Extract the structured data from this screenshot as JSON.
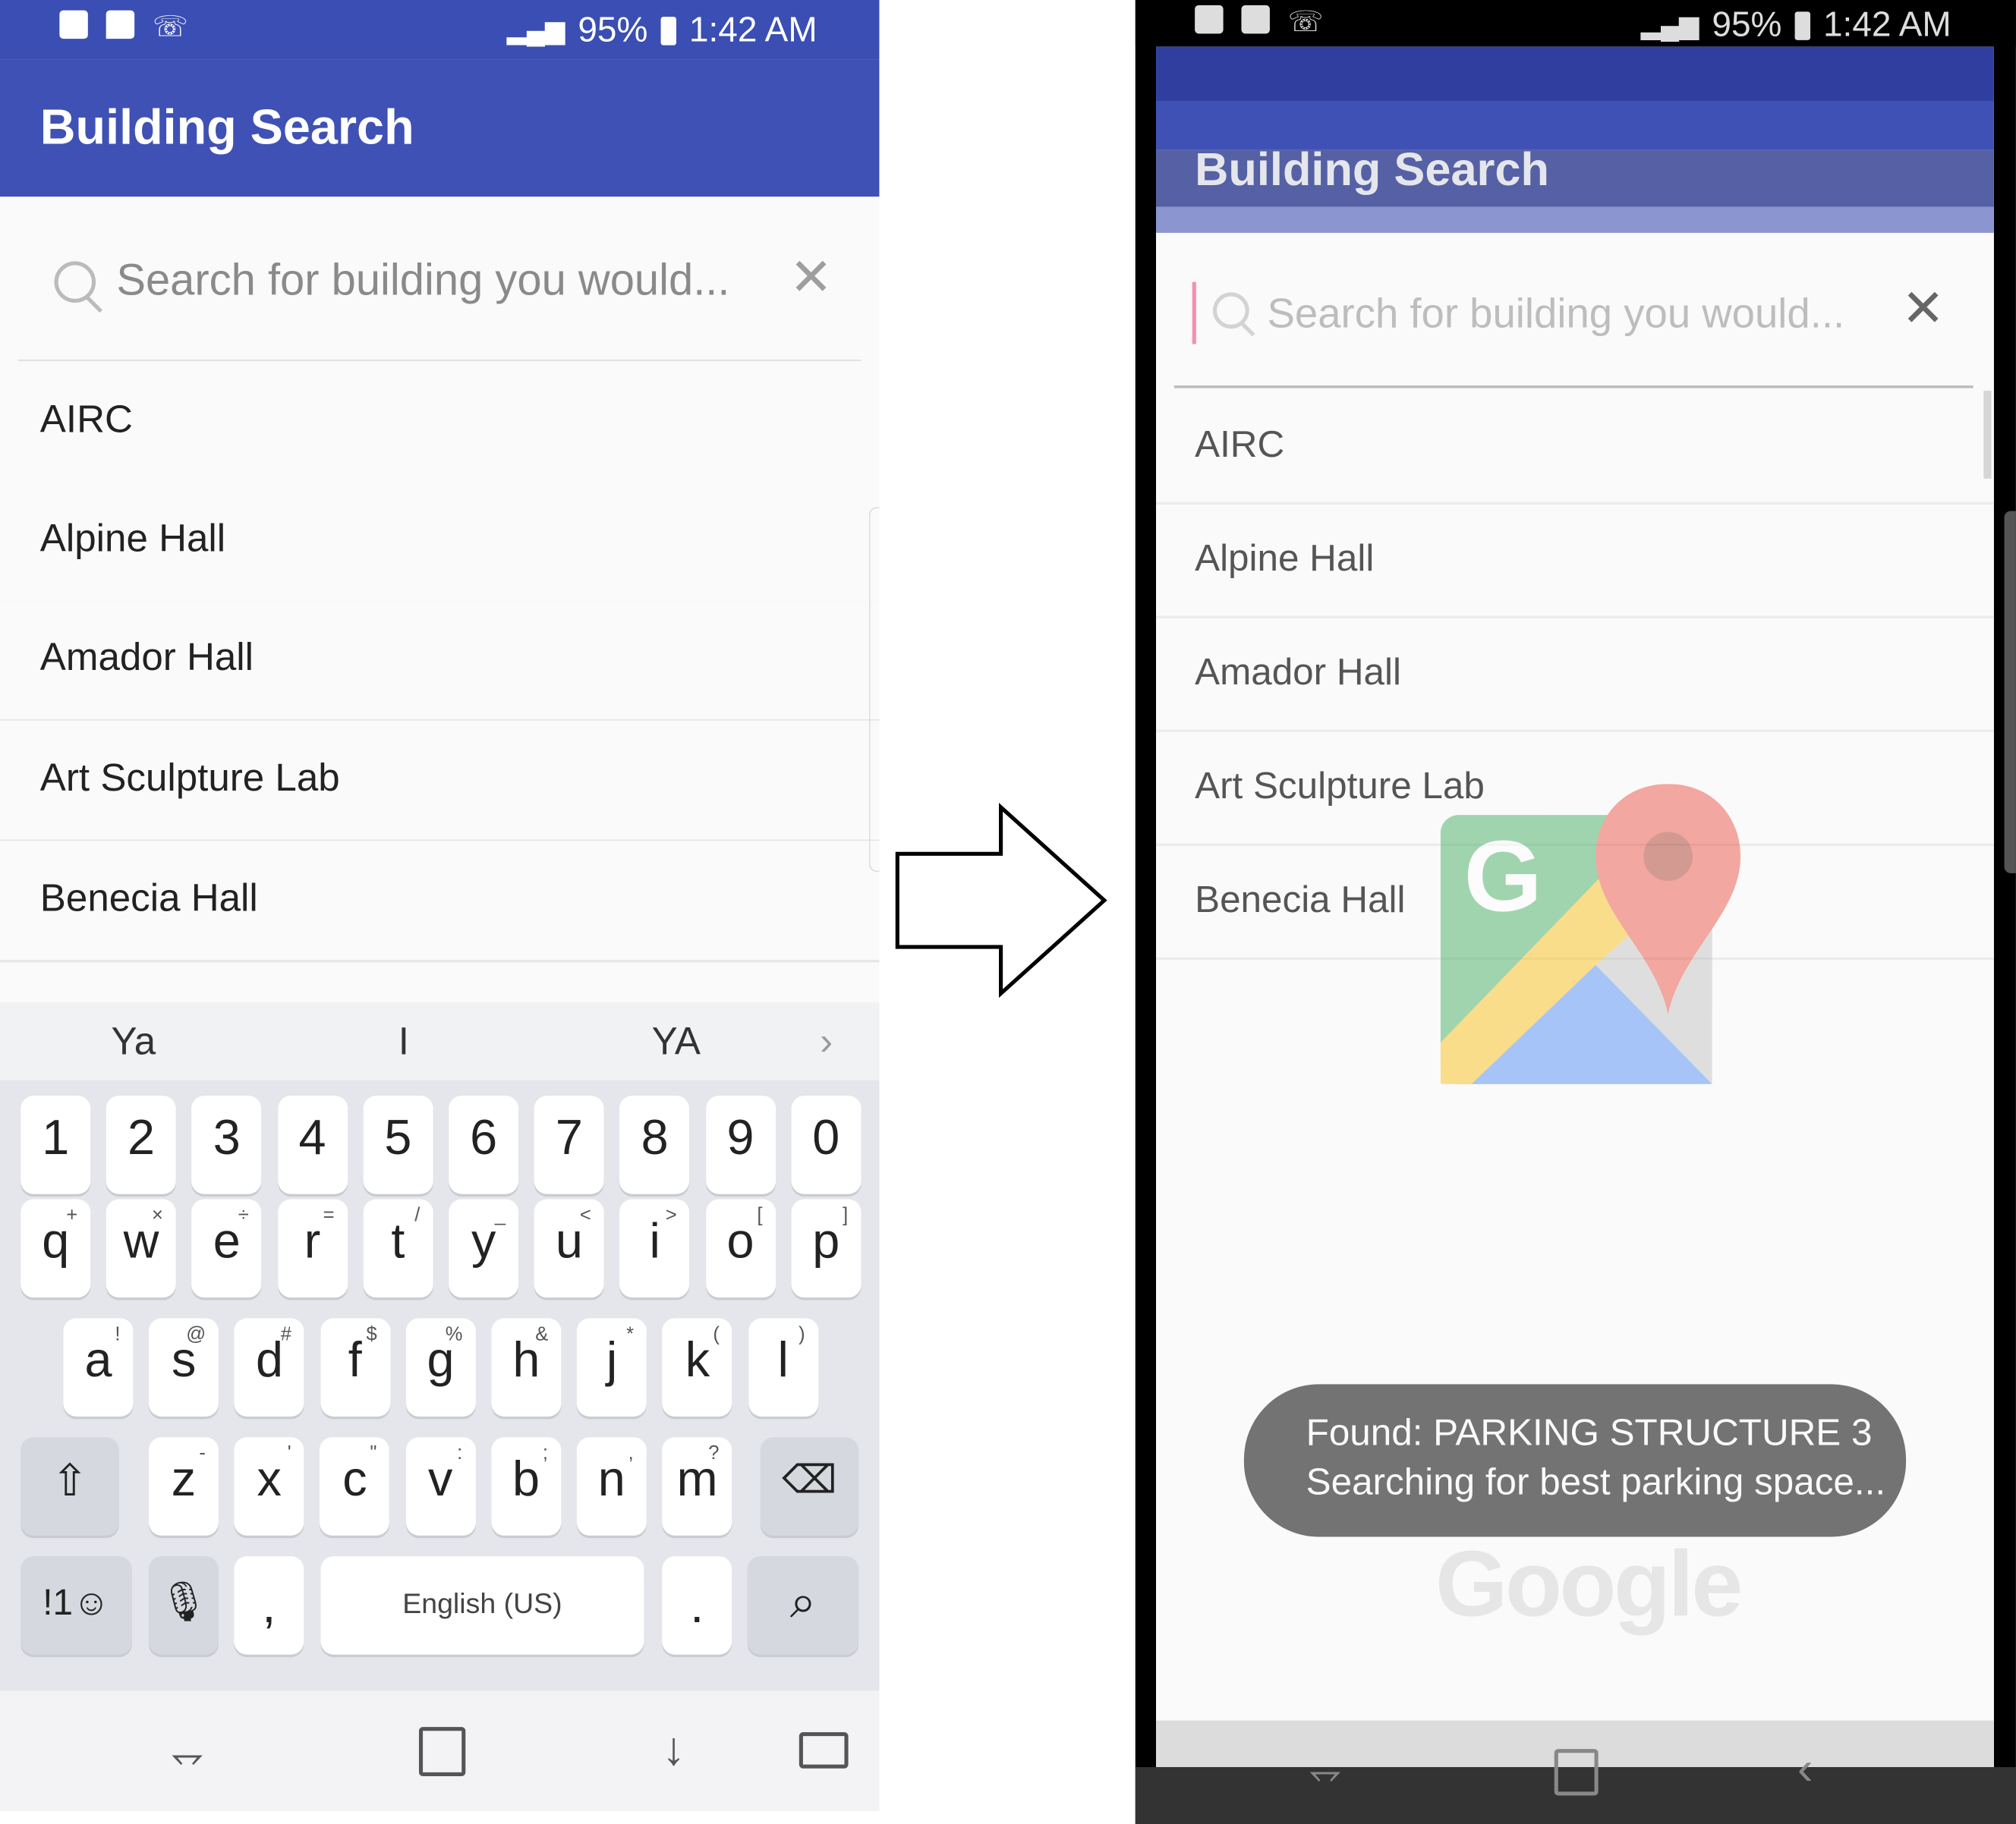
{
  "left_phone": {
    "status": {
      "battery": "95%",
      "time": "1:42 AM"
    },
    "title": "Building Search",
    "search": {
      "placeholder": "Search for building you would...",
      "clear": "✕"
    },
    "buildings": [
      "AIRC",
      "Alpine Hall",
      "Amador Hall",
      "Art Sculpture Lab",
      "Benecia Hall"
    ],
    "keyboard": {
      "suggestions": [
        "Ya",
        "I",
        "YA"
      ],
      "numbers": [
        "1",
        "2",
        "3",
        "4",
        "5",
        "6",
        "7",
        "8",
        "9",
        "0"
      ],
      "row1": [
        [
          "q",
          "+"
        ],
        [
          "w",
          "×"
        ],
        [
          "e",
          "÷"
        ],
        [
          "r",
          "="
        ],
        [
          "t",
          "/"
        ],
        [
          "y",
          "_"
        ],
        [
          "u",
          "<"
        ],
        [
          "i",
          ">"
        ],
        [
          "o",
          "["
        ],
        [
          "p",
          "]"
        ]
      ],
      "row2": [
        [
          "a",
          "!"
        ],
        [
          "s",
          "@"
        ],
        [
          "d",
          "#"
        ],
        [
          "f",
          "$"
        ],
        [
          "g",
          "%"
        ],
        [
          "h",
          "&"
        ],
        [
          "j",
          "*"
        ],
        [
          "k",
          "("
        ],
        [
          "l",
          ")"
        ]
      ],
      "row3": [
        [
          "z",
          "-"
        ],
        [
          "x",
          "'"
        ],
        [
          "c",
          "\""
        ],
        [
          "v",
          ":"
        ],
        [
          "b",
          ";"
        ],
        [
          "n",
          ","
        ],
        [
          "m",
          "?"
        ]
      ],
      "symbols_key": "!1☺",
      "comma": ",",
      "space_label": "English (US)",
      "period": "."
    }
  },
  "right_phone": {
    "status": {
      "battery": "95%",
      "time": "1:42 AM"
    },
    "title": "Building Search",
    "search": {
      "placeholder": "Search for building you would...",
      "clear": "✕"
    },
    "buildings": [
      "AIRC",
      "Alpine Hall",
      "Amador Hall",
      "Art Sculpture Lab",
      "Benecia Hall"
    ],
    "toast_line1": "Found: PARKING STRUCTURE 3",
    "toast_line2": "Searching for best parking space...",
    "brand": "Google"
  },
  "colors": {
    "app_bar": "#3f51b5",
    "status_bar": "#3a4eb3",
    "toast": "#737373"
  },
  "icons": [
    "search-icon",
    "close-icon",
    "wifi-icon",
    "signal-icon",
    "battery-icon",
    "arrow-right-icon",
    "google-maps-icon",
    "microphone-icon",
    "backspace-icon",
    "shift-icon"
  ]
}
